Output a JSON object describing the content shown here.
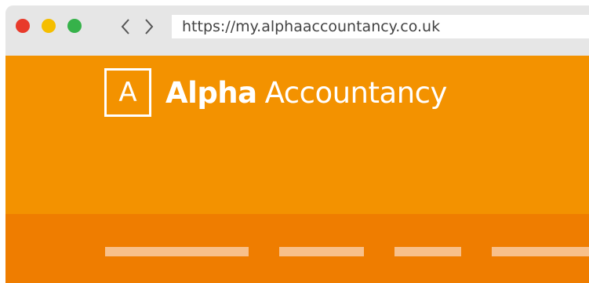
{
  "browser": {
    "window_controls": [
      {
        "name": "close",
        "color": "#e83a2b"
      },
      {
        "name": "minimize",
        "color": "#f5be00"
      },
      {
        "name": "maximize",
        "color": "#36b24a"
      }
    ],
    "back_icon": "chevron-left",
    "forward_icon": "chevron-right",
    "url": "https://my.alphaaccountancy.co.uk"
  },
  "site": {
    "logo_mark": "A",
    "brand_bold": "Alpha",
    "brand_light": "Accountancy",
    "header_color": "#f39200",
    "nav_color": "#ef7d00",
    "nav_placeholder_color": "#f8c08a"
  }
}
